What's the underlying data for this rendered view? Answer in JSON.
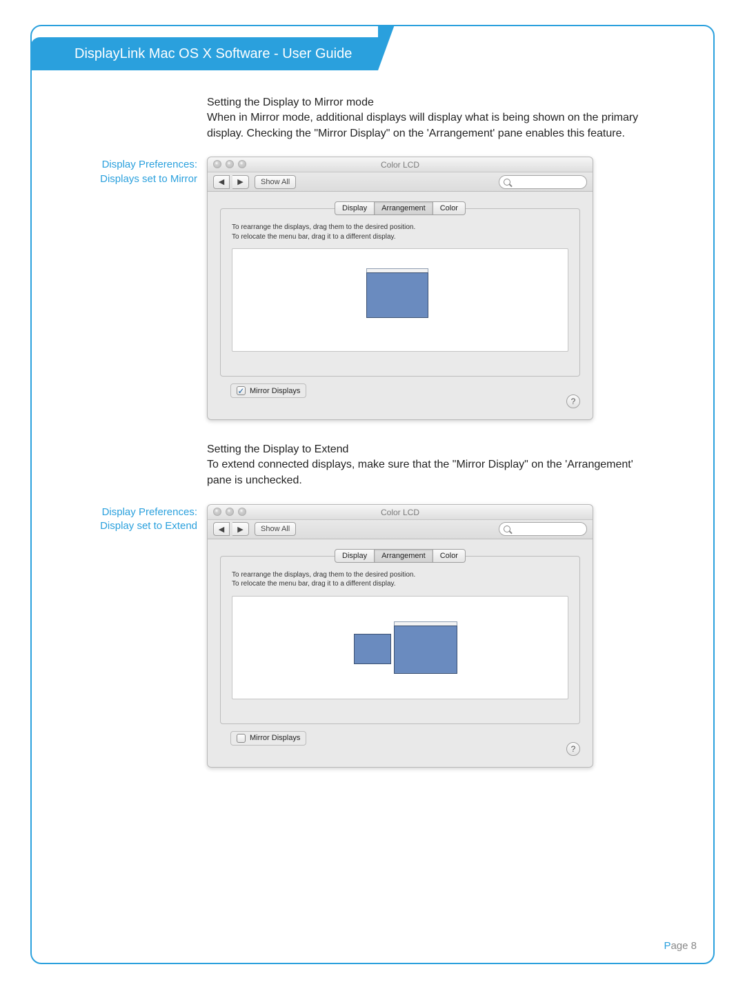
{
  "header": {
    "title": "DisplayLink Mac OS X Software - User Guide"
  },
  "section1": {
    "heading": "Setting the Display to Mirror mode",
    "body": "When in Mirror mode, additional displays will display what is being shown on the primary display. Checking the \"Mirror Display\" on the 'Arrangement' pane enables this feature."
  },
  "caption1_line1": "Display Preferences:",
  "caption1_line2": "Displays set to Mirror",
  "section2": {
    "heading": "Setting the Display to Extend",
    "body": "To extend connected displays, make sure that the \"Mirror Display\" on the 'Arrangement' pane is unchecked."
  },
  "caption2_line1": "Display Preferences:",
  "caption2_line2": "Display set to Extend",
  "prefs": {
    "window_title": "Color LCD",
    "back_glyph": "◀",
    "fwd_glyph": "▶",
    "show_all": "Show All",
    "tabs": {
      "display": "Display",
      "arrangement": "Arrangement",
      "color": "Color"
    },
    "hint1": "To rearrange the displays, drag them to the desired position.",
    "hint2": "To relocate the menu bar, drag it to a different display.",
    "mirror_label": "Mirror Displays",
    "help_glyph": "?",
    "check_glyph": "✓"
  },
  "page": {
    "p": "P",
    "rest": "age 8"
  }
}
